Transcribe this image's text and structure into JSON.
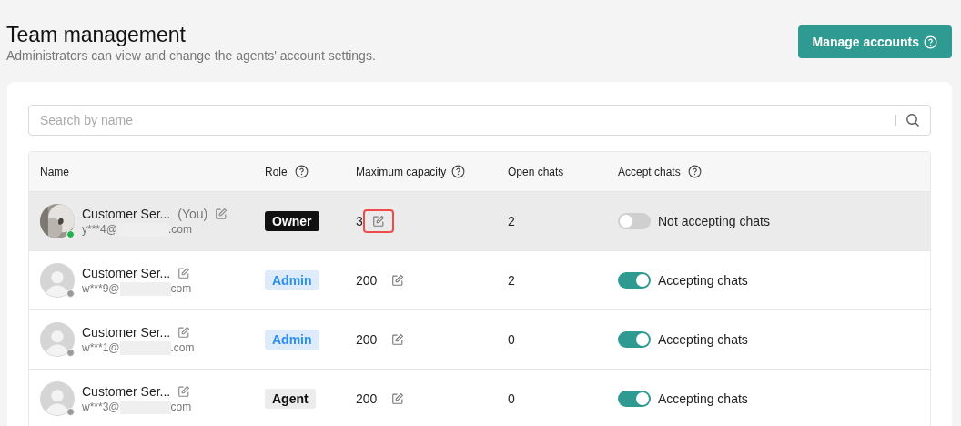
{
  "header": {
    "title": "Team management",
    "subtitle": "Administrators can view and change the agents' account settings.",
    "button": "Manage accounts"
  },
  "search": {
    "placeholder": "Search by name"
  },
  "table": {
    "columns": [
      {
        "label": "Name",
        "help": false
      },
      {
        "label": "Role",
        "help": true
      },
      {
        "label": "Maximum capacity",
        "help": true
      },
      {
        "label": "Open chats",
        "help": false
      },
      {
        "label": "Accept chats",
        "help": true
      }
    ],
    "rows": [
      {
        "name": "Customer Ser...",
        "you": "(You)",
        "email_start": "y***4@",
        "email_end": ".com",
        "online": true,
        "highlighted": true,
        "role": {
          "label": "Owner",
          "kind": "owner"
        },
        "capacity": "3",
        "capacity_marked": true,
        "open_chats": "2",
        "accepting": false,
        "accept_label": "Not accepting chats"
      },
      {
        "name": "Customer Ser...",
        "email_start": "w***9@",
        "email_end": "com",
        "avatar": {
          "kind": "default"
        },
        "online": false,
        "highlighted": false,
        "role": {
          "label": "Admin",
          "kind": "admin"
        },
        "capacity": "200",
        "capacity_marked": false,
        "open_chats": "2",
        "accepting": true,
        "accept_label": "Accepting chats"
      },
      {
        "name": "Customer Ser...",
        "email_start": "w***1@",
        "email_end": ".com",
        "avatar": {
          "kind": "default"
        },
        "online": false,
        "highlighted": false,
        "role": {
          "label": "Admin",
          "kind": "admin"
        },
        "capacity": "200",
        "capacity_marked": false,
        "open_chats": "0",
        "accepting": true,
        "accept_label": "Accepting chats"
      },
      {
        "name": "Customer Ser...",
        "email_start": "w***3@",
        "email_end": "com",
        "avatar": {
          "kind": "default"
        },
        "online": false,
        "highlighted": false,
        "role": {
          "label": "Agent",
          "kind": "agent"
        },
        "capacity": "200",
        "capacity_marked": false,
        "open_chats": "0",
        "accepting": true,
        "accept_label": "Accepting chats"
      }
    ]
  }
}
